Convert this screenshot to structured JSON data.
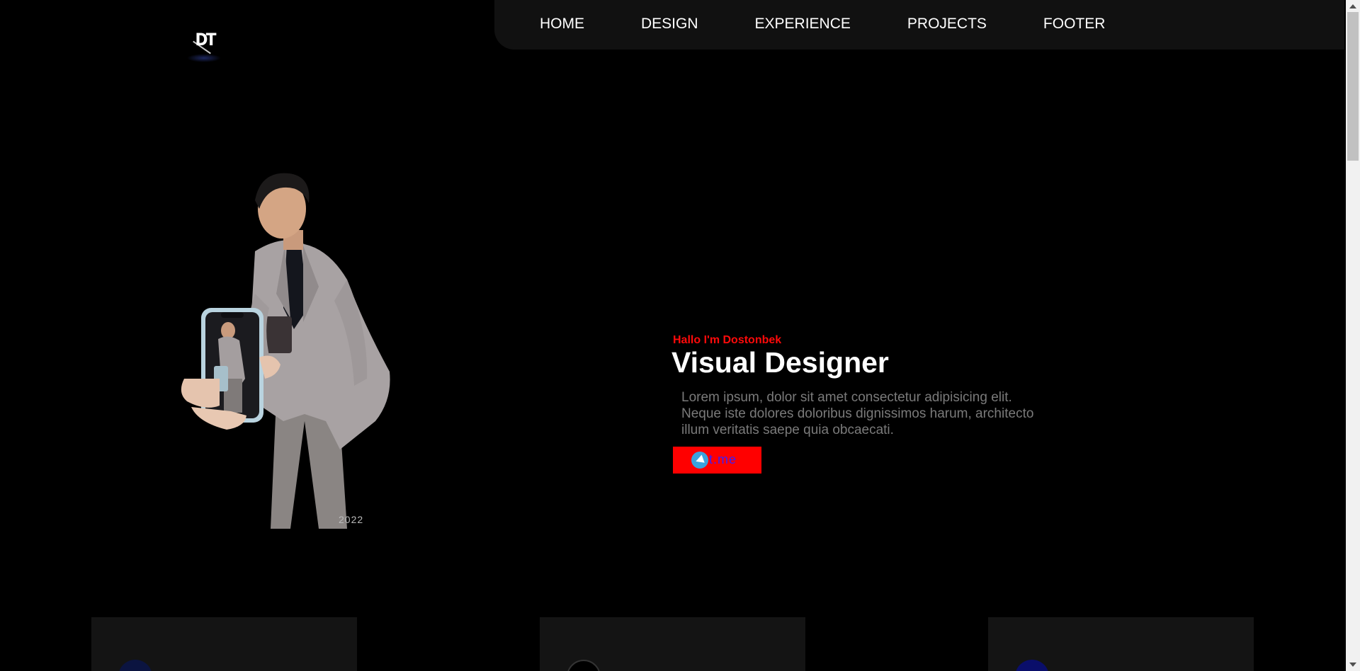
{
  "brand": {
    "logo_icon": "dt-monogram-logo"
  },
  "nav": {
    "items": [
      {
        "label": "HOME"
      },
      {
        "label": "DESIGN"
      },
      {
        "label": "EXPERIENCE"
      },
      {
        "label": "PROJECTS"
      },
      {
        "label": "FOOTER"
      }
    ]
  },
  "hero": {
    "greeting": "Hallo I'm Dostonbek",
    "title": "Visual Designer",
    "description": "Lorem ipsum, dolor sit amet consectetur adipisicing elit. Neque iste dolores doloribus dignissimos harum, architecto illum veritatis saepe quia obcaecati.",
    "cta": {
      "label": "t.me",
      "icon": "telegram-icon"
    },
    "portrait": {
      "year_label": "2022"
    }
  },
  "cards": [
    {
      "icon": "navy-circle-icon"
    },
    {
      "icon": "dark-circle-icon"
    },
    {
      "icon": "blue-circle-icon"
    }
  ],
  "colors": {
    "background": "#000000",
    "nav_background": "#111111",
    "accent": "#ff0000",
    "greeting": "#ff0a0a",
    "title": "#ffffff",
    "body_text": "#7a7a7a",
    "cta_text": "#3a1dff",
    "card_background": "#141414"
  }
}
